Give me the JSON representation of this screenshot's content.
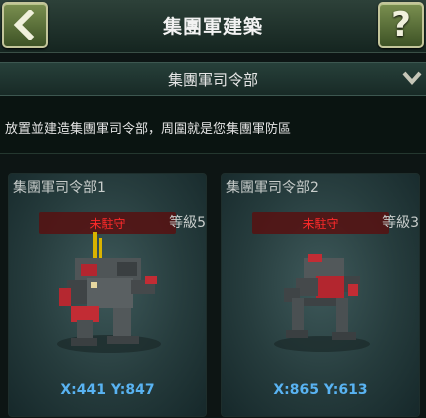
{
  "header": {
    "title": "集團軍建築",
    "back_icon": "back-arrow-icon",
    "help_label": "?"
  },
  "section": {
    "title": "集團軍司令部",
    "toggle_icon": "chevron-down-icon"
  },
  "description": "放置並建造集團軍司令部，周圍就是您集團軍防區",
  "cards": [
    {
      "title": "集團軍司令部1",
      "status": "未駐守",
      "level": "等級5",
      "coords": "X:441 Y:847"
    },
    {
      "title": "集團軍司令部2",
      "status": "未駐守",
      "level": "等級3",
      "coords": "X:865 Y:613"
    }
  ],
  "colors": {
    "status_text": "#ff2a2a",
    "coords_text": "#59b3f2",
    "button_fill": "#5f7a38"
  }
}
